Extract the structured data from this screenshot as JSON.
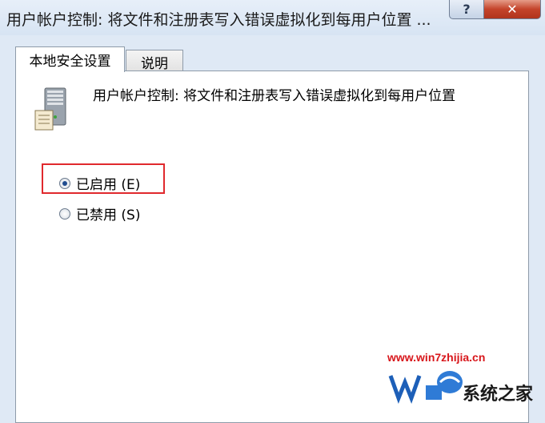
{
  "window": {
    "title": "用户帐户控制: 将文件和注册表写入错误虚拟化到每用户位置 ...",
    "help_glyph": "?",
    "close_glyph": "✕"
  },
  "tabs": [
    {
      "label": "本地安全设置",
      "active": true
    },
    {
      "label": "说明",
      "active": false
    }
  ],
  "policy": {
    "icon": "server-policy-icon",
    "description": "用户帐户控制: 将文件和注册表写入错误虚拟化到每用户位置"
  },
  "options": [
    {
      "label": "已启用 (E)",
      "selected": true
    },
    {
      "label": "已禁用 (S)",
      "selected": false
    }
  ],
  "watermark": {
    "url": "www.win7zhijia.cn",
    "brand": "系统之家"
  },
  "colors": {
    "highlight": "#e0292d",
    "close_button": "#c4432a",
    "watermark_url": "#d8161b"
  }
}
